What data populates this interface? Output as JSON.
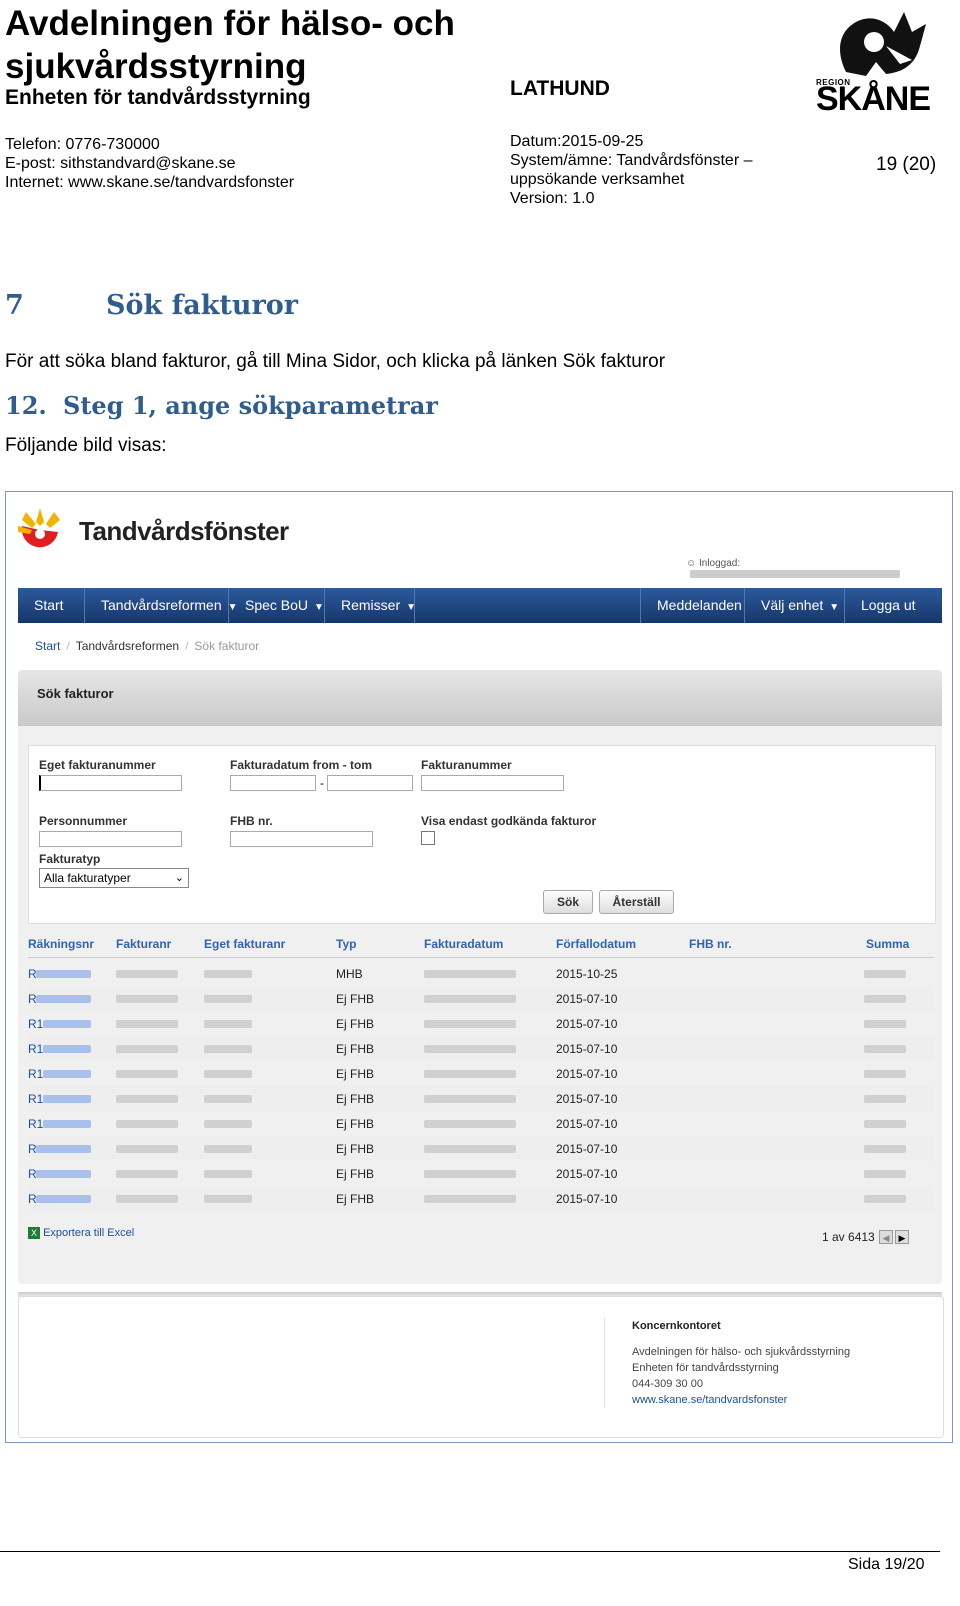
{
  "header": {
    "org_line1": "Avdelningen för hälso- och",
    "org_line2": "sjukvårdsstyrning",
    "sub_org": "Enheten för tandvårdsstyrning",
    "phone": "Telefon: 0776-730000",
    "email": "E-post: sithstandvard@skane.se",
    "web": "Internet: www.skane.se/tandvardsfonster",
    "doc_type": "LATHUND",
    "date": "Datum:2015-09-25",
    "system_line1": "System/ämne: Tandvårdsfönster –",
    "system_line2": "uppsökande verksamhet",
    "version": "Version: 1.0",
    "page": "19 (20)",
    "logo_region": "REGION",
    "logo_name": "SKÅNE"
  },
  "section": {
    "number": "7",
    "title": "Sök fakturor",
    "intro": "För att söka bland fakturor, gå till Mina Sidor, och klicka på länken Sök fakturor",
    "step_number": "12.",
    "step_title": "Steg 1, ange sökparametrar",
    "caption": "Följande bild visas:"
  },
  "app": {
    "name": "Tandvårdsfönster",
    "login_label": "Inloggad:",
    "nav": [
      "Start",
      "Tandvårdsreformen",
      "Spec BoU",
      "Remisser",
      "Meddelanden",
      "Välj enhet",
      "Logga ut"
    ],
    "breadcrumb": [
      "Start",
      "Tandvårdsreformen",
      "Sök fakturor"
    ],
    "panel_title": "Sök fakturor",
    "form": {
      "own_invoice_label": "Eget fakturanummer",
      "date_label": "Fakturadatum from - tom",
      "date_sep": "-",
      "invoice_label": "Fakturanummer",
      "person_label": "Personnummer",
      "fhb_label": "FHB nr.",
      "approved_label": "Visa endast godkända fakturor",
      "type_label": "Fakturatyp",
      "type_value": "Alla fakturatyper",
      "search_button": "Sök",
      "reset_button": "Återställ"
    },
    "table": {
      "headers": [
        "Räkningsnr",
        "Fakturanr",
        "Eget fakturanr",
        "Typ",
        "Fakturadatum",
        "Förfallodatum",
        "FHB nr.",
        "Summa"
      ],
      "rows": [
        {
          "prefix": "R",
          "typ": "MHB",
          "due": "2015-10-25"
        },
        {
          "prefix": "R",
          "typ": "Ej FHB",
          "due": "2015-07-10"
        },
        {
          "prefix": "R1",
          "typ": "Ej FHB",
          "due": "2015-07-10"
        },
        {
          "prefix": "R1",
          "typ": "Ej FHB",
          "due": "2015-07-10"
        },
        {
          "prefix": "R1",
          "typ": "Ej FHB",
          "due": "2015-07-10"
        },
        {
          "prefix": "R1",
          "typ": "Ej FHB",
          "due": "2015-07-10"
        },
        {
          "prefix": "R1",
          "typ": "Ej FHB",
          "due": "2015-07-10"
        },
        {
          "prefix": "R",
          "typ": "Ej FHB",
          "due": "2015-07-10"
        },
        {
          "prefix": "R",
          "typ": "Ej FHB",
          "due": "2015-07-10"
        },
        {
          "prefix": "R",
          "typ": "Ej FHB",
          "due": "2015-07-10"
        }
      ]
    },
    "export_label": "Exportera till Excel",
    "pager": "1 av 6413",
    "footer": {
      "title": "Koncernkontoret",
      "line1": "Avdelningen för hälso- och sjukvårdsstyrning",
      "line2": "Enheten för tandvårdsstyrning",
      "phone": "044-309 30 00",
      "link": "www.skane.se/tandvardsfonster"
    }
  },
  "page_footer": "Sida 19/20"
}
